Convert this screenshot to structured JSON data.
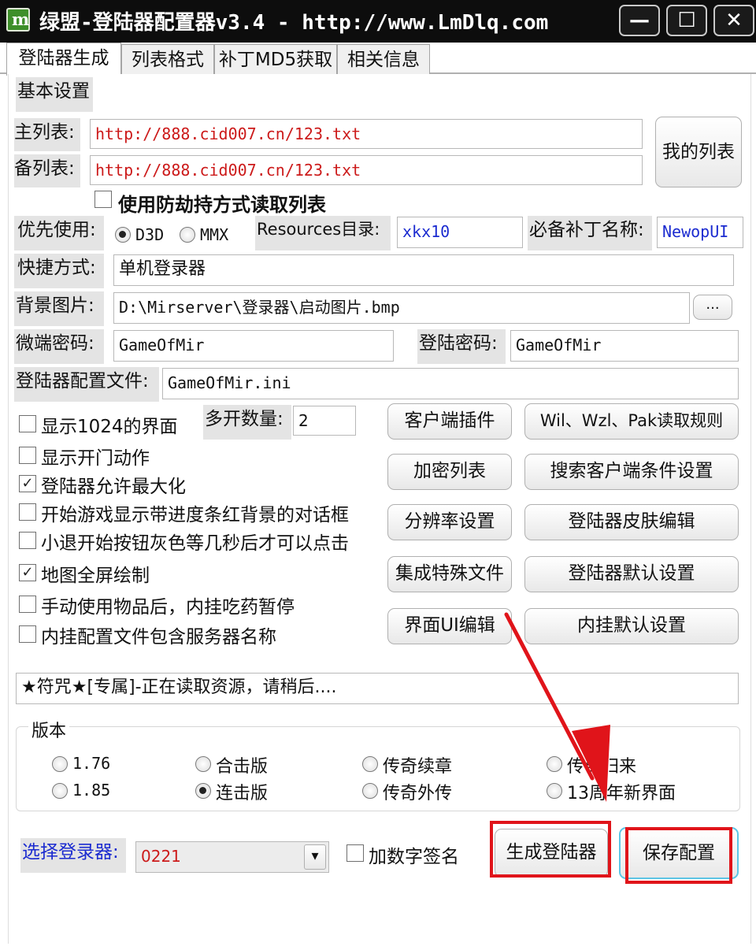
{
  "window": {
    "title": "绿盟-登陆器配置器v3.4 - http://www.LmDlq.com",
    "logo_letter": "m",
    "min_glyph": "—",
    "max_glyph": "☐",
    "close_glyph": "✕"
  },
  "tabs": [
    "登陆器生成",
    "列表格式",
    "补丁MD5获取",
    "相关信息"
  ],
  "basic": {
    "section_title": "基本设置",
    "main_list_label": "主列表:",
    "main_list_value": "http://888.cid007.cn/123.txt",
    "backup_list_label": "备列表:",
    "backup_list_value": "http://888.cid007.cn/123.txt",
    "my_list_button": "我的列表",
    "anti_hijack_label": "使用防劫持方式读取列表",
    "priority_label": "优先使用:",
    "priority_options": [
      "D3D",
      "MMX"
    ],
    "resources_label": "Resources目录:",
    "resources_value": "xkx10",
    "patch_label": "必备补丁名称:",
    "patch_value": "NewopUI",
    "shortcut_label": "快捷方式:",
    "shortcut_value": "单机登录器",
    "bg_label": "背景图片:",
    "bg_value": "D:\\Mirserver\\登录器\\启动图片.bmp",
    "browse_button": "...",
    "wd_label": "微端密码:",
    "wd_value": "GameOfMir",
    "login_pwd_label": "登陆密码:",
    "login_pwd_value": "GameOfMir",
    "config_label": "登陆器配置文件:",
    "config_value": "GameOfMir.ini"
  },
  "checkboxes": [
    {
      "label": "显示1024的界面",
      "checked": false,
      "mark": ""
    },
    {
      "label": "显示开门动作",
      "checked": false,
      "mark": ""
    },
    {
      "label": "登陆器允许最大化",
      "checked": true,
      "mark": "✓"
    },
    {
      "label": "开始游戏显示带进度条红背景的对话框",
      "checked": false,
      "mark": ""
    },
    {
      "label": "小退开始按钮灰色等几秒后才可以点击",
      "checked": false,
      "mark": ""
    },
    {
      "label": "地图全屏绘制",
      "checked": true,
      "mark": "✓"
    },
    {
      "label": "手动使用物品后，内挂吃药暂停",
      "checked": false,
      "mark": ""
    },
    {
      "label": "内挂配置文件包含服务器名称",
      "checked": false,
      "mark": ""
    }
  ],
  "multi": {
    "label": "多开数量:",
    "value": "2"
  },
  "buttons": {
    "client_plugin": "客户端插件",
    "wil_rule": "Wil、Wzl、Pak读取规则",
    "encrypt_list": "加密列表",
    "search_client": "搜索客户端条件设置",
    "resolution": "分辨率设置",
    "skin_edit": "登陆器皮肤编辑",
    "special_files": "集成特殊文件",
    "default_settings": "登陆器默认设置",
    "ui_edit": "界面UI编辑",
    "plugin_default": "内挂默认设置"
  },
  "status_text": "★符咒★[专属]-正在读取资源，请稍后....",
  "version": {
    "title": "版本",
    "options": [
      {
        "label": "1.76",
        "selected": false
      },
      {
        "label": "合击版",
        "selected": false
      },
      {
        "label": "传奇续章",
        "selected": false
      },
      {
        "label": "传奇归来",
        "selected": false
      },
      {
        "label": "1.85",
        "selected": false
      },
      {
        "label": "连击版",
        "selected": true
      },
      {
        "label": "传奇外传",
        "selected": false
      },
      {
        "label": "13周年新界面",
        "selected": false
      }
    ]
  },
  "bottom": {
    "select_label": "选择登录器:",
    "select_value": "0221",
    "dropdown_glyph": "▾",
    "digital_sign_label": "加数字签名",
    "generate_button": "生成登陆器",
    "save_button": "保存配置"
  },
  "colors": {
    "annotation_red": "#e0141a",
    "select_label_blue": "#1b2bd0",
    "url_red": "#cc1a1a"
  }
}
